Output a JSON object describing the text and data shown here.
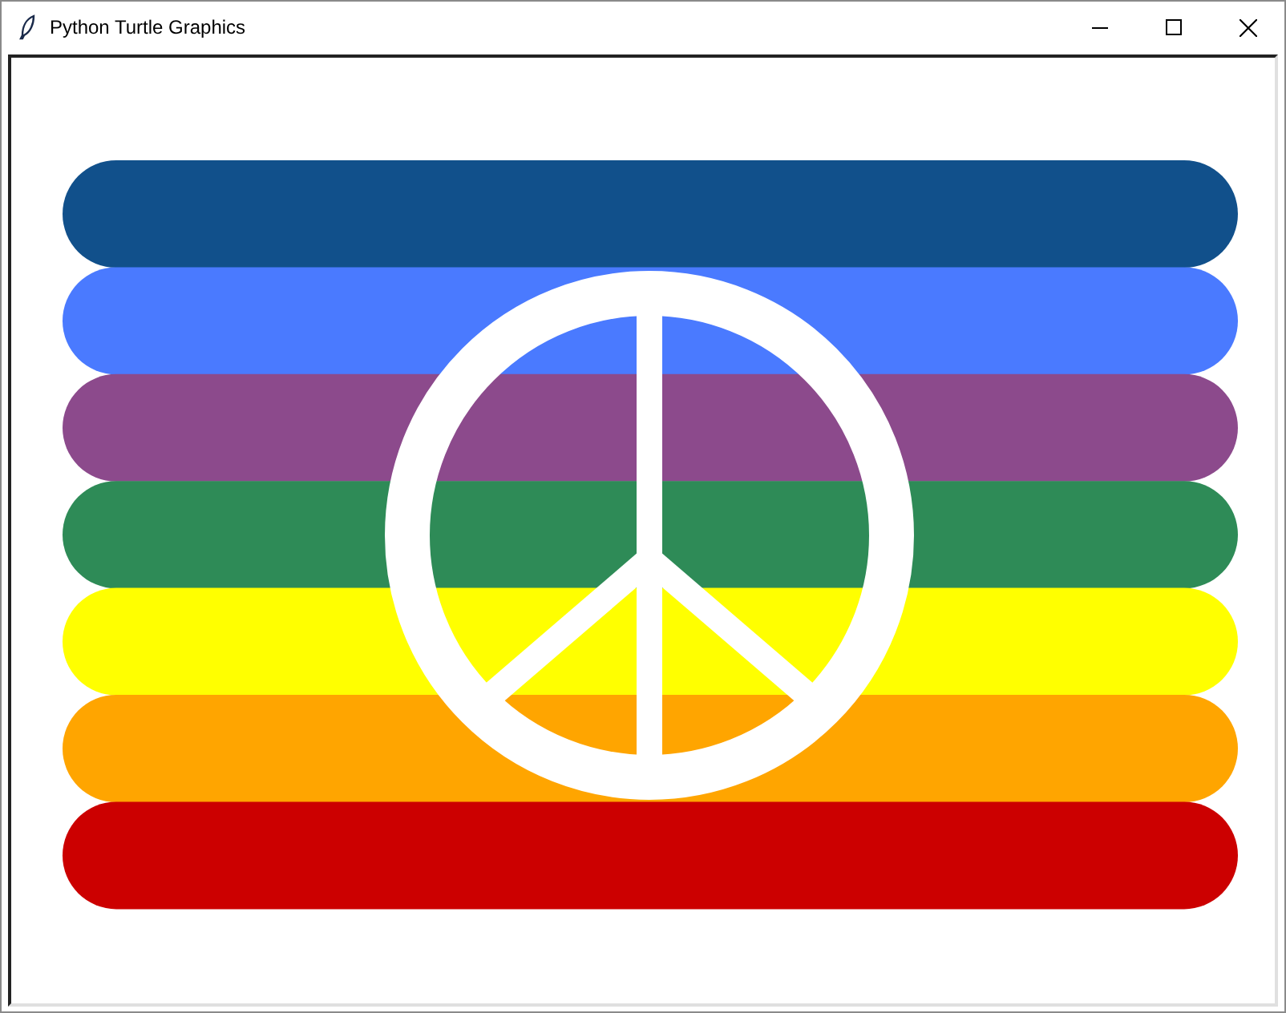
{
  "window": {
    "title": "Python Turtle Graphics"
  },
  "stripes": [
    {
      "color": "#11508b"
    },
    {
      "color": "#4a7aff"
    },
    {
      "color": "#8c4a8c"
    },
    {
      "color": "#2e8b57"
    },
    {
      "color": "#ffff00"
    },
    {
      "color": "#ffa500"
    },
    {
      "color": "#cc0000"
    }
  ]
}
